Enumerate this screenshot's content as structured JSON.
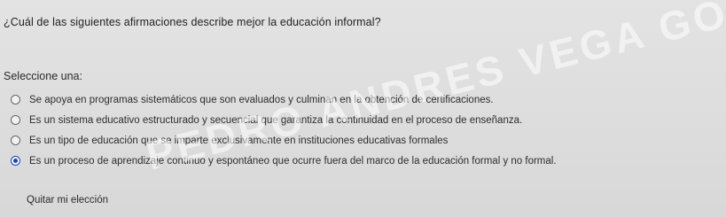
{
  "question": {
    "text": "¿Cuál de las siguientes afirmaciones describe mejor la educación informal?"
  },
  "prompt": {
    "text": "Seleccione una:"
  },
  "options": [
    {
      "label": "Se apoya en programas sistemáticos que son evaluados y culminan en la obtención de certificaciones.",
      "selected": false
    },
    {
      "label": "Es un sistema educativo estructurado y secuencial que garantiza la continuidad en el proceso de enseñanza.",
      "selected": false
    },
    {
      "label": "Es un tipo de educación que se imparte exclusivamente en instituciones educativas formales",
      "selected": false
    },
    {
      "label": "Es un proceso de aprendizaje continuo y espontáneo que ocurre fuera del marco de la educación formal y no formal.",
      "selected": true
    }
  ],
  "clear_choice": {
    "label": "Quitar mi elección"
  },
  "watermark": {
    "text": "PEDRO ANDRES VEGA GOMEZ"
  },
  "colors": {
    "accent": "#1d3fb8",
    "background": "#dedede",
    "text": "#2a2a2a"
  }
}
